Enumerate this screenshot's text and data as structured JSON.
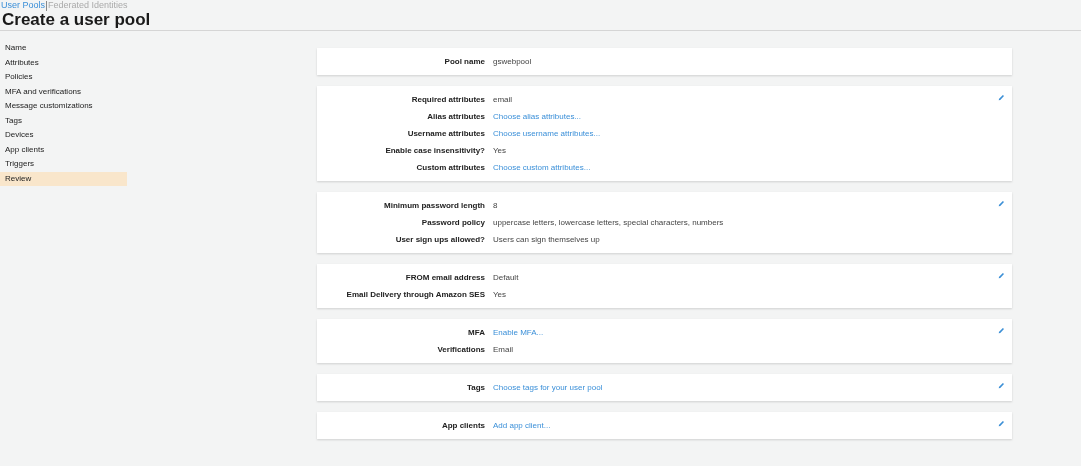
{
  "tabs": [
    {
      "label": "User Pools",
      "selected": true
    },
    {
      "label": "Federated Identities",
      "selected": false
    }
  ],
  "title": "Create a user pool",
  "sidebar": {
    "items": [
      {
        "label": "Name",
        "selected": false
      },
      {
        "label": "Attributes",
        "selected": false
      },
      {
        "label": "Policies",
        "selected": false
      },
      {
        "label": "MFA and verifications",
        "selected": false
      },
      {
        "label": "Message customizations",
        "selected": false
      },
      {
        "label": "Tags",
        "selected": false
      },
      {
        "label": "Devices",
        "selected": false
      },
      {
        "label": "App clients",
        "selected": false
      },
      {
        "label": "Triggers",
        "selected": false
      },
      {
        "label": "Review",
        "selected": true
      }
    ]
  },
  "sections": [
    {
      "editable": false,
      "rows": [
        {
          "label": "Pool name",
          "value": "gswebpool",
          "kind": "text"
        }
      ]
    },
    {
      "editable": true,
      "rows": [
        {
          "label": "Required attributes",
          "value": "email",
          "kind": "text"
        },
        {
          "label": "Alias attributes",
          "value": "Choose alias attributes...",
          "kind": "link"
        },
        {
          "label": "Username attributes",
          "value": "Choose username attributes...",
          "kind": "link"
        },
        {
          "label": "Enable case insensitivity?",
          "value": "Yes",
          "kind": "text"
        },
        {
          "label": "Custom attributes",
          "value": "Choose custom attributes...",
          "kind": "link"
        }
      ]
    },
    {
      "editable": true,
      "rows": [
        {
          "label": "Minimum password length",
          "value": "8",
          "kind": "text"
        },
        {
          "label": "Password policy",
          "value": "uppercase letters, lowercase letters, special characters, numbers",
          "kind": "text"
        },
        {
          "label": "User sign ups allowed?",
          "value": "Users can sign themselves up",
          "kind": "text"
        }
      ]
    },
    {
      "editable": true,
      "rows": [
        {
          "label": "FROM email address",
          "value": "Default",
          "kind": "text"
        },
        {
          "label": "Email Delivery through Amazon SES",
          "value": "Yes",
          "kind": "text"
        }
      ]
    },
    {
      "editable": true,
      "rows": [
        {
          "label": "MFA",
          "value": "Enable MFA...",
          "kind": "link"
        },
        {
          "label": "Verifications",
          "value": "Email",
          "kind": "text"
        }
      ]
    },
    {
      "editable": true,
      "rows": [
        {
          "label": "Tags",
          "value": "Choose tags for your user pool",
          "kind": "link"
        }
      ]
    },
    {
      "editable": true,
      "rows": [
        {
          "label": "App clients",
          "value": "Add app client...",
          "kind": "link"
        }
      ]
    }
  ]
}
